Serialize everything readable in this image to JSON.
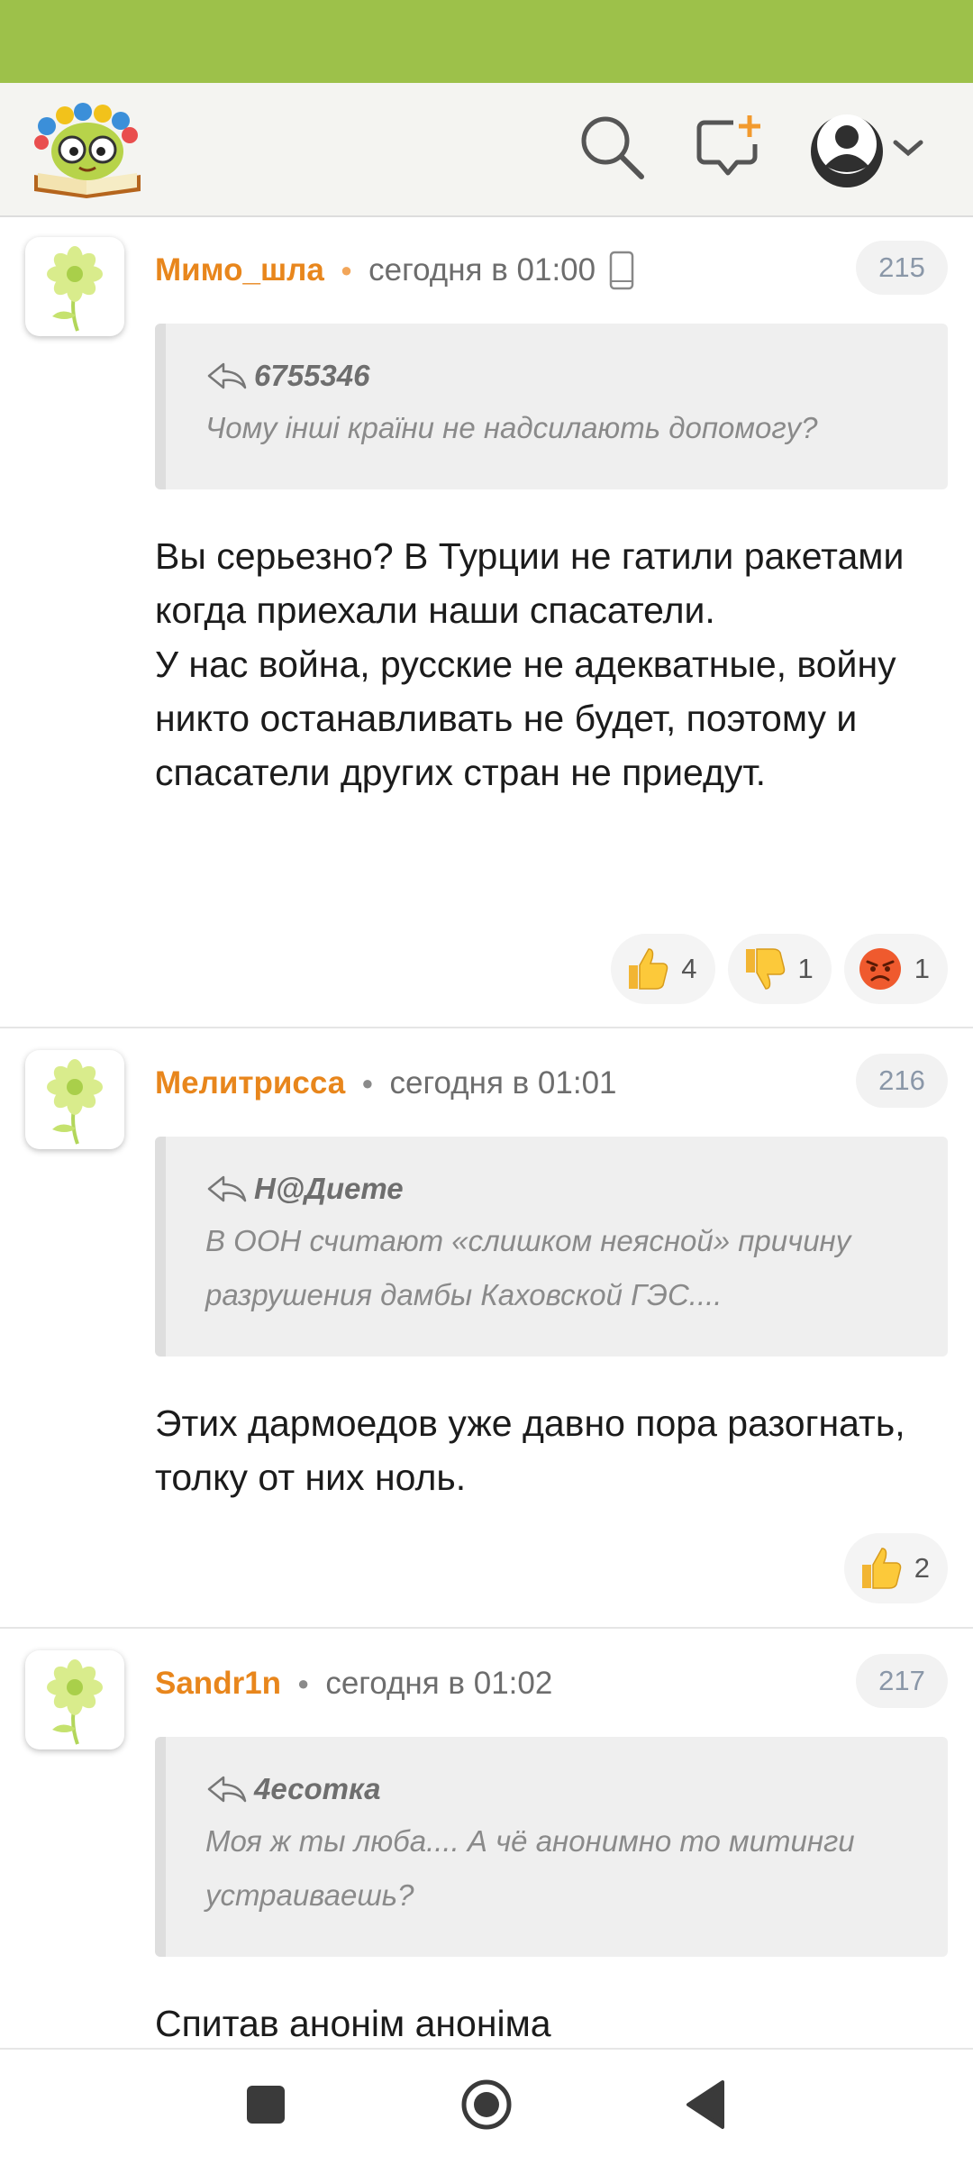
{
  "colors": {
    "accent": "#9dc14a",
    "author": "#e8861c",
    "counter": "#8a97a8"
  },
  "topbar": {
    "icons": [
      "logo",
      "search-icon",
      "add-comment-icon",
      "user-avatar-icon",
      "chevron-down-icon"
    ]
  },
  "comments": [
    {
      "author": "Мимо_шла",
      "time": "сегодня в 01:00",
      "device_icon": "phone-icon",
      "number": "215",
      "quote": {
        "author": "6755346",
        "text": "Чому інші країни не надсилають допомогу?"
      },
      "text": "Вы серьезно? В Турции не гатили ракетами когда приехали наши спасатели.\nУ нас война, русские не адекватные, войну никто останавливать не будет, поэтому и спасатели других стран не приедут.",
      "reactions": [
        {
          "icon": "thumbs-up-icon",
          "count": "4"
        },
        {
          "icon": "thumbs-down-icon",
          "count": "1"
        },
        {
          "icon": "angry-face-icon",
          "count": "1"
        }
      ]
    },
    {
      "author": "Мелитрисса",
      "time": "сегодня в 01:01",
      "number": "216",
      "quote": {
        "author": "Н@Диете",
        "text": "В ООН считают «слишком неясной» причину разрушения дамбы Каховской ГЭС...."
      },
      "text": "Этих дармоедов уже давно пора разогнать, толку от них ноль.",
      "reactions": [
        {
          "icon": "thumbs-up-icon",
          "count": "2"
        }
      ]
    },
    {
      "author": "Sandr1n",
      "time": "сегодня в 01:02",
      "number": "217",
      "quote": {
        "author": "4есотка",
        "text": "Моя ж ты люба.... А чё анонимно то митинги устраиваешь?"
      },
      "text": "Спитав анонім аноніма"
    }
  ],
  "navbar": {
    "icons": [
      "recent-apps-icon",
      "home-icon",
      "back-icon"
    ]
  }
}
